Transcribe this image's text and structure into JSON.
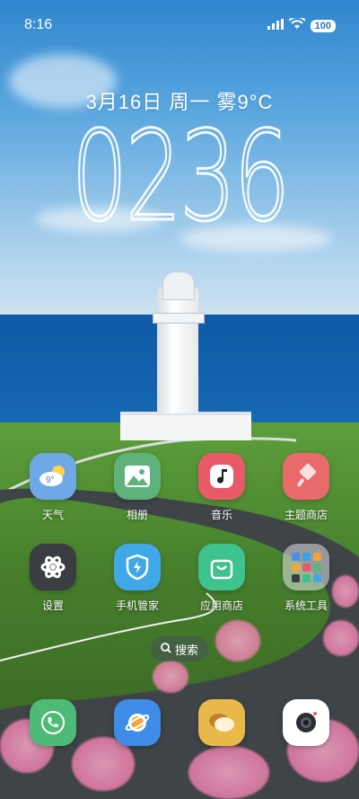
{
  "status_bar": {
    "time": "8:16",
    "battery": "100"
  },
  "lockscreen": {
    "date_weather": "3月16日 周一 雾9°C",
    "clock": "0236"
  },
  "apps_row1": [
    {
      "label": "天气",
      "icon": "weather-icon",
      "bg": "#6fa8e6",
      "badge": "9°"
    },
    {
      "label": "相册",
      "icon": "gallery-icon",
      "bg": "#5fb27c"
    },
    {
      "label": "音乐",
      "icon": "music-icon",
      "bg": "#e85a67"
    },
    {
      "label": "主题商店",
      "icon": "theme-store-icon",
      "bg": "#e86a6a"
    }
  ],
  "apps_row2": [
    {
      "label": "设置",
      "icon": "settings-icon",
      "bg": "#3a3d42"
    },
    {
      "label": "手机管家",
      "icon": "security-icon",
      "bg": "#41a8e8"
    },
    {
      "label": "应用商店",
      "icon": "app-store-icon",
      "bg": "#3ec28e"
    },
    {
      "label": "系统工具",
      "icon": "folder-icon",
      "bg": "rgba(220,225,230,0.55)"
    }
  ],
  "search": {
    "label": "搜索"
  },
  "dock": [
    {
      "icon": "phone-icon",
      "bg": "#4dbb77"
    },
    {
      "icon": "browser-icon",
      "bg": "#3f8be8"
    },
    {
      "icon": "messages-icon",
      "bg": "#e8b84a"
    },
    {
      "icon": "camera-icon",
      "bg": "#ffffff"
    }
  ]
}
